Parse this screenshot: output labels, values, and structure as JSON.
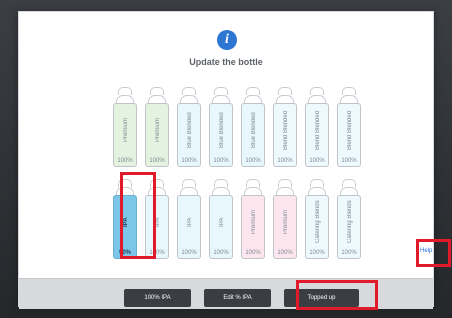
{
  "modal": {
    "title": "Update the bottle",
    "help_label": "Help"
  },
  "bottles": [
    {
      "label": "Premium",
      "pct": "100%",
      "color": "#e3f3df"
    },
    {
      "label": "Premium",
      "pct": "100%",
      "color": "#e3f3df"
    },
    {
      "label": "Blue Blended",
      "pct": "100%",
      "color": "#e8f7fc"
    },
    {
      "label": "Blue Blended",
      "pct": "100%",
      "color": "#e8f7fc"
    },
    {
      "label": "Blue Blended",
      "pct": "100%",
      "color": "#e8f7fc"
    },
    {
      "label": "Blend Blended",
      "pct": "100%",
      "color": "#eef9fd"
    },
    {
      "label": "Blend Blended",
      "pct": "100%",
      "color": "#eef9fd"
    },
    {
      "label": "Blend Blended",
      "pct": "100%",
      "color": "#eef9fd"
    },
    {
      "label": "IPA",
      "pct": "90%",
      "color": "#7cc6ea",
      "selected": true
    },
    {
      "label": "IPA",
      "pct": "100%",
      "color": "#e8f7fc"
    },
    {
      "label": "IPA",
      "pct": "100%",
      "color": "#e8f7fc"
    },
    {
      "label": "IPA",
      "pct": "100%",
      "color": "#e8f7fc"
    },
    {
      "label": "Premium",
      "pct": "100%",
      "color": "#fde5ee"
    },
    {
      "label": "Premium",
      "pct": "100%",
      "color": "#fde5ee"
    },
    {
      "label": "Catering Blends",
      "pct": "100%",
      "color": "#eef9fd"
    },
    {
      "label": "Catering Blends",
      "pct": "100%",
      "color": "#eef9fd"
    }
  ],
  "footer": {
    "button_1": "100% IPA",
    "button_2": "Edit % IPA",
    "button_3": "Topped up"
  }
}
